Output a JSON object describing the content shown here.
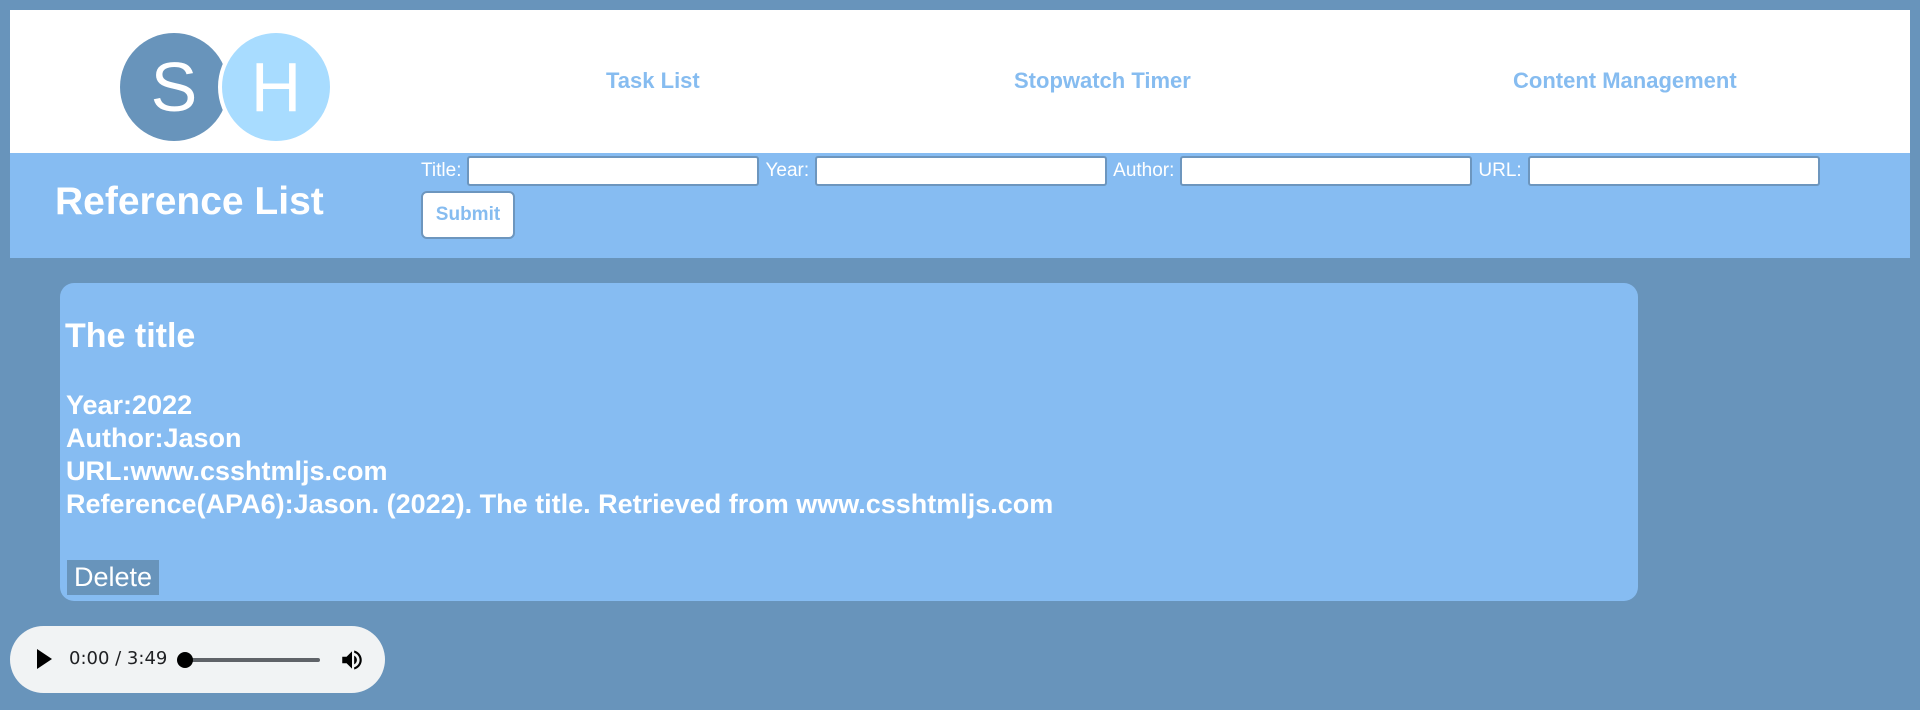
{
  "logo": {
    "letter_left": "S",
    "letter_right": "H"
  },
  "nav": {
    "items": [
      {
        "label": "Task List"
      },
      {
        "label": "Stopwatch Timer"
      },
      {
        "label": "Content Management"
      }
    ]
  },
  "header": {
    "title": "Reference List"
  },
  "form": {
    "title_label": "Title:",
    "year_label": "Year:",
    "author_label": "Author:",
    "url_label": "URL:",
    "title_value": "",
    "year_value": "",
    "author_value": "",
    "url_value": "",
    "submit_label": "Submit"
  },
  "reference": {
    "title": "The title",
    "year_line": "Year:2022",
    "author_line": "Author:Jason",
    "url_line": "URL:www.csshtmljs.com",
    "apa_line": "Reference(APA6):Jason. (2022). The title. Retrieved from www.csshtmljs.com",
    "delete_label": "Delete"
  },
  "audio": {
    "time_display": "0:00 / 3:49",
    "progress": 0,
    "play_icon": "play-icon",
    "volume_icon": "volume-icon"
  },
  "colors": {
    "page_bg": "#6894bb",
    "accent_blue": "#86bcf2",
    "logo_light": "#a8dcff",
    "white": "#ffffff"
  }
}
